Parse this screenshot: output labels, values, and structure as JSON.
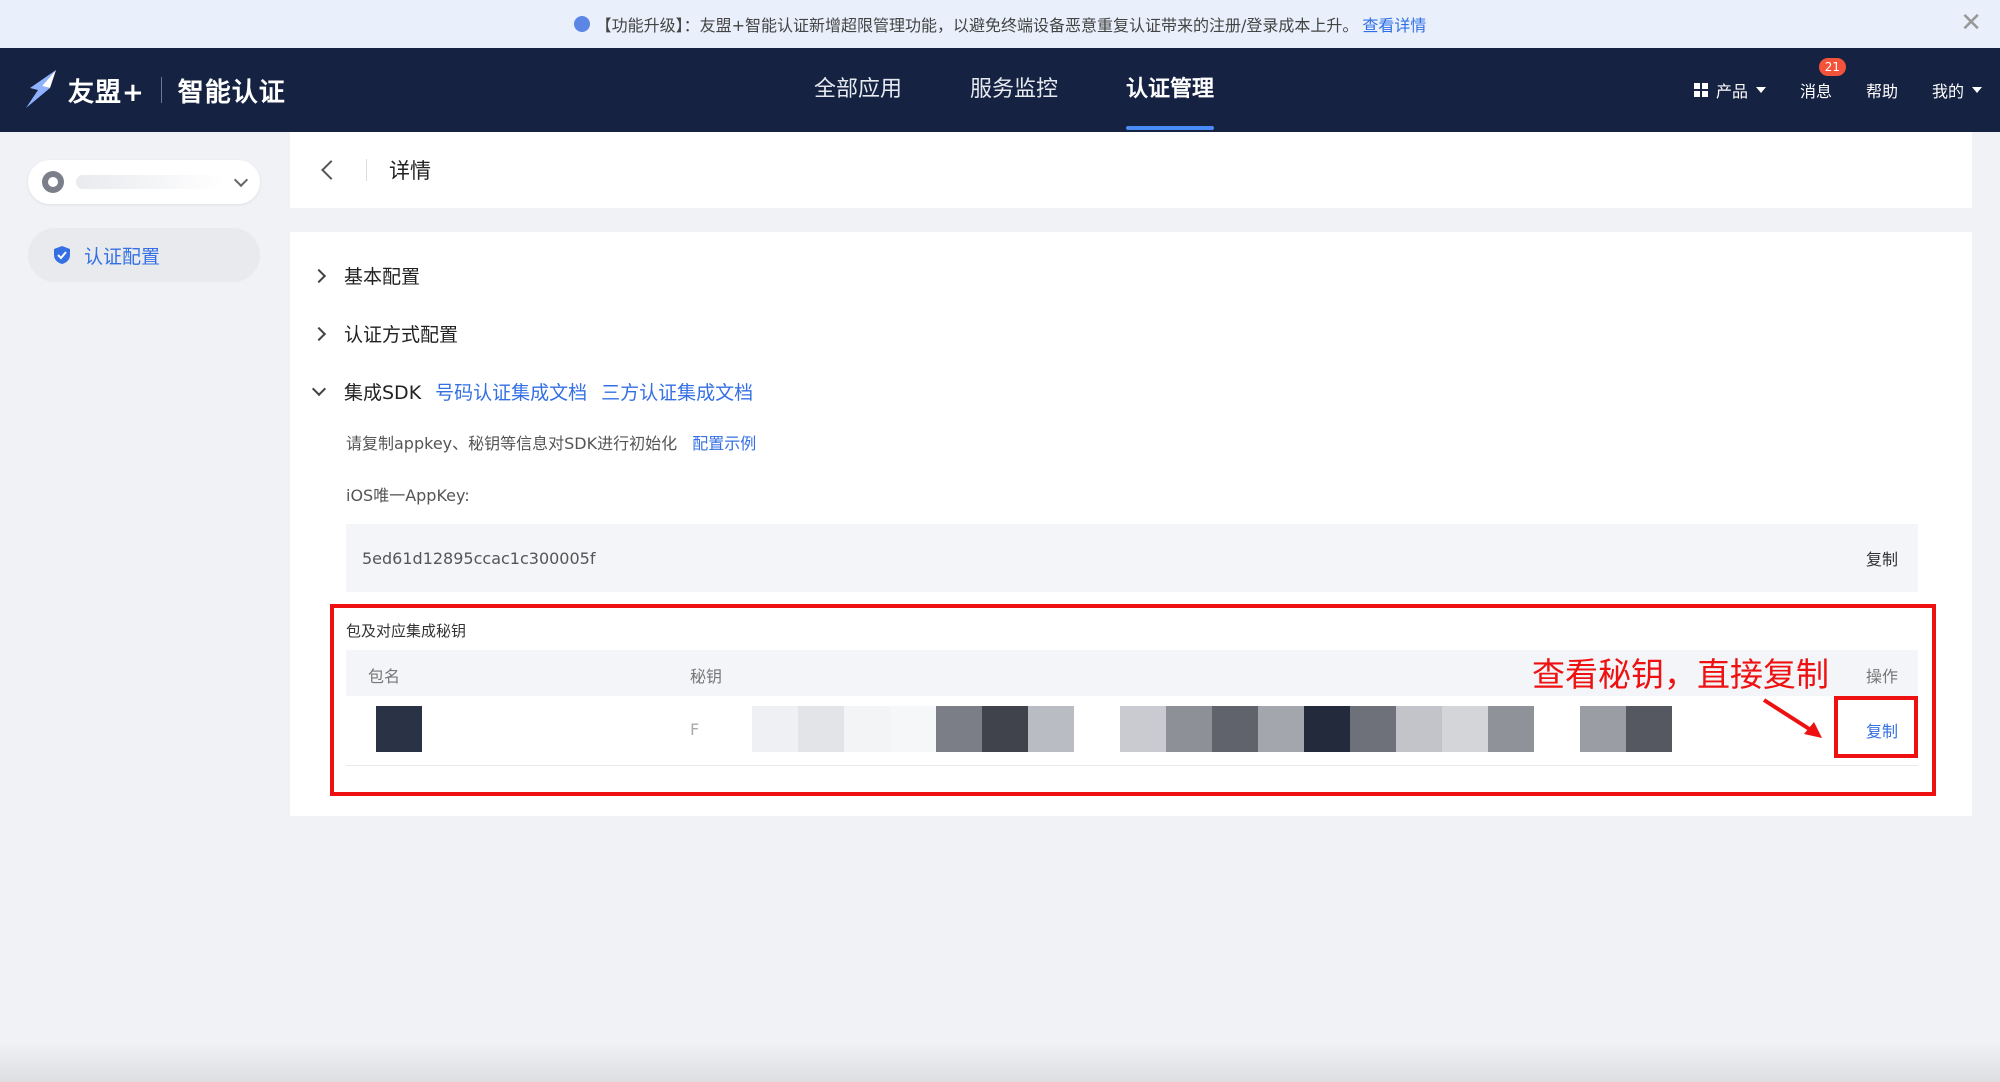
{
  "notice": {
    "prefix": "【功能升级】：",
    "text": "友盟+智能认证新增超限管理功能，以避免终端设备恶意重复认证带来的注册/登录成本上升。",
    "link": "查看详情",
    "close": "✕"
  },
  "brand": {
    "name": "友盟+",
    "sub": "智能认证"
  },
  "nav": {
    "items": [
      "全部应用",
      "服务监控",
      "认证管理"
    ],
    "active": "认证管理"
  },
  "rightnav": {
    "product": "产品",
    "messages": "消息",
    "message_count": "21",
    "help": "帮助",
    "mine": "我的"
  },
  "sidebar": {
    "item_label": "认证配置",
    "accent": "#3470e4"
  },
  "header": {
    "title": "详情"
  },
  "sections": {
    "basic": "基本配置",
    "auth_method": "认证方式配置",
    "sdk": "集成SDK",
    "sdk_links": [
      "号码认证集成文档",
      "三方认证集成文档"
    ]
  },
  "sdk": {
    "hint": "请复制appkey、秘钥等信息对SDK进行初始化",
    "hint_link": "配置示例",
    "appkey_label": "iOS唯一AppKey:",
    "appkey_value": "5ed61d12895ccac1c300005f",
    "copy": "复制",
    "pkg_title": "包及对应集成秘钥",
    "columns": [
      "包名",
      "秘钥",
      "操作"
    ],
    "row_secret_prefix": "F",
    "row_action": "复制"
  },
  "annotation": {
    "text": "查看秘钥，直接复制",
    "color": "#e11111"
  }
}
